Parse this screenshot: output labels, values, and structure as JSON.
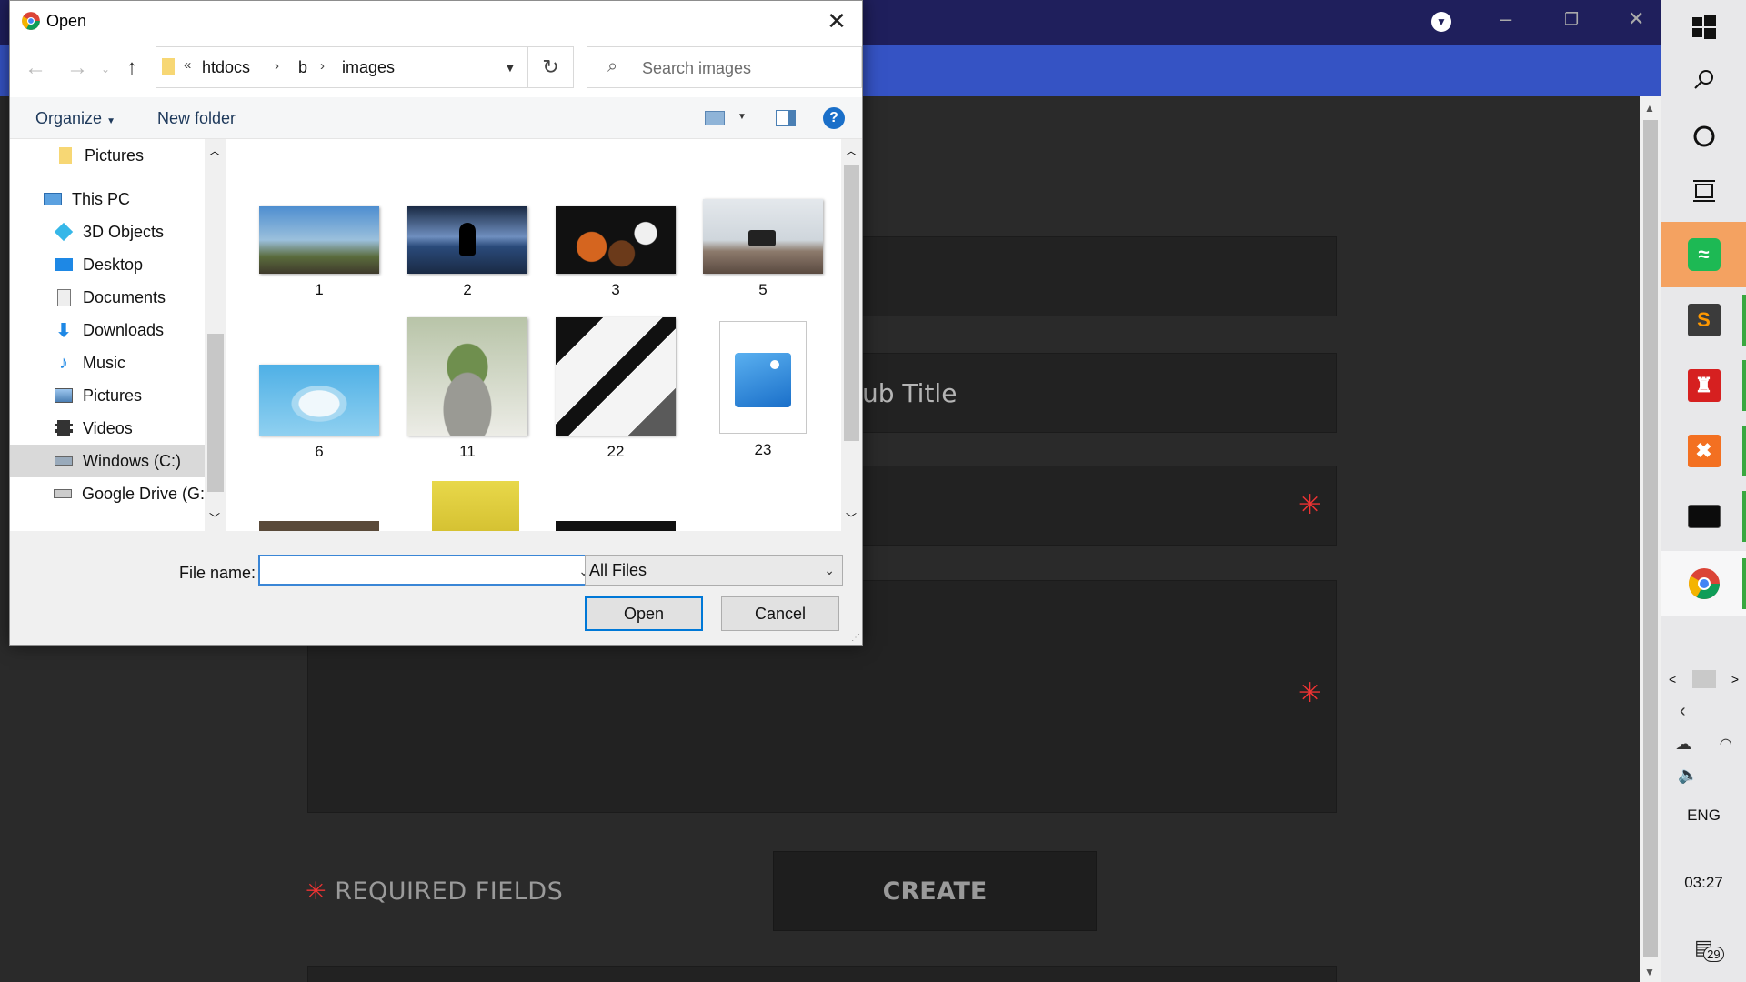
{
  "dialog": {
    "title": "Open",
    "address": [
      "htdocs",
      "b",
      "images"
    ],
    "address_prefix": "«",
    "search_placeholder": "Search images",
    "organize_label": "Organize",
    "new_folder_label": "New folder",
    "nav_items": [
      {
        "label": "Pictures",
        "icon": "folder-icon"
      },
      {
        "label": "This PC",
        "icon": "this-pc-icon"
      },
      {
        "label": "3D Objects",
        "icon": "3d-objects-icon"
      },
      {
        "label": "Desktop",
        "icon": "desktop-icon"
      },
      {
        "label": "Documents",
        "icon": "documents-icon"
      },
      {
        "label": "Downloads",
        "icon": "downloads-icon"
      },
      {
        "label": "Music",
        "icon": "music-icon"
      },
      {
        "label": "Pictures",
        "icon": "pictures-icon"
      },
      {
        "label": "Videos",
        "icon": "videos-icon"
      },
      {
        "label": "Windows (C:)",
        "icon": "drive-icon",
        "selected": true
      },
      {
        "label": "Google Drive (G:",
        "icon": "drive-icon"
      }
    ],
    "files": [
      {
        "name": "1",
        "colors": [
          "#5a8ec8",
          "#7aa0b8",
          "#4f5e3c"
        ]
      },
      {
        "name": "2",
        "colors": [
          "#6f8fbf",
          "#1a2a44",
          "#3a5f8f"
        ]
      },
      {
        "name": "3",
        "colors": [
          "#111111",
          "#c0501e",
          "#2a6a2a"
        ]
      },
      {
        "name": "5",
        "colors": [
          "#d6dbe0",
          "#7e7e7e",
          "#4a3a32"
        ]
      },
      {
        "name": "6",
        "colors": [
          "#5fb6e6",
          "#a8d9f2",
          "#e8f4fb"
        ]
      },
      {
        "name": "11",
        "colors": [
          "#c8cfc0",
          "#7c9a5a",
          "#e4e4de"
        ]
      },
      {
        "name": "22",
        "colors": [
          "#ffffff",
          "#111111",
          "#8a8a8a"
        ]
      },
      {
        "name": "23",
        "colors": [
          "#ffffff",
          "#1e7fd6",
          "#6fb6f0"
        ]
      }
    ],
    "filename_label": "File name:",
    "filename_value": "",
    "filetype_value": "All Files",
    "open_label": "Open",
    "cancel_label": "Cancel"
  },
  "page": {
    "subtitle_placeholder": "ub Title",
    "required_star": "✳",
    "required_label": "REQUIRED FIELDS",
    "create_label": "CREATE"
  },
  "taskbar": {
    "language": "ENG",
    "time": "03:27",
    "notification_count": "29"
  },
  "colors": {
    "browser_frame": "#1f1f5c",
    "browser_toolbar": "#3553c4",
    "spotify_tile": "#f4a261",
    "accent_red": "#ee3333"
  }
}
